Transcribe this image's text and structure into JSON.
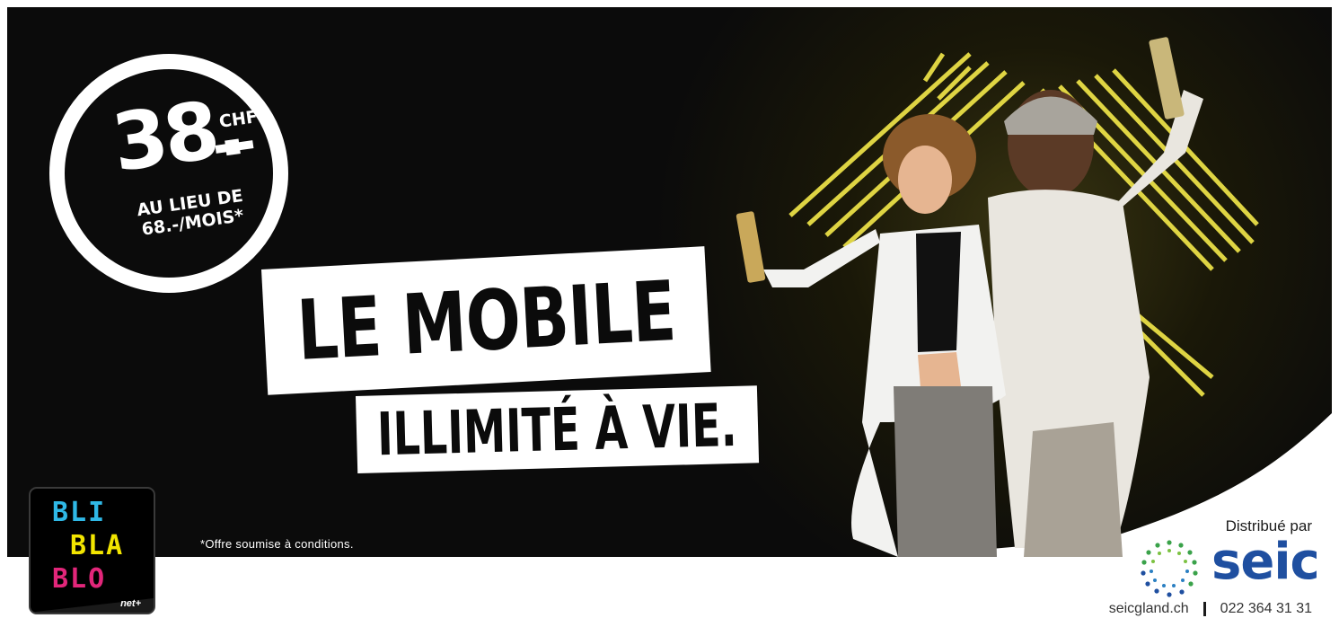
{
  "price": {
    "amount": "38.",
    "currency": "CHF",
    "dash": "–",
    "instead_of_line1": "AU LIEU DE",
    "instead_of_line2": "68.-/MOIS*"
  },
  "headline": {
    "line1": "LE MOBILE",
    "line2": "ILLIMITÉ À VIE."
  },
  "disclaimer": "*Offre soumise à conditions.",
  "blibla_logo": {
    "row1": "BLI",
    "row2": "BLA",
    "row3": "BLO",
    "brand": "net+",
    "colors": {
      "bli": "#2fb8e6",
      "bla": "#f2e500",
      "blo": "#e2267a"
    }
  },
  "distributor": {
    "label": "Distribué par",
    "name": "seic",
    "website": "seicgland.ch",
    "phone": "022 364 31 31",
    "brand_color": "#1f4fa0"
  },
  "colors": {
    "background_dark": "#0b0b0b",
    "neon": "#f4e94a",
    "text_white": "#ffffff"
  }
}
